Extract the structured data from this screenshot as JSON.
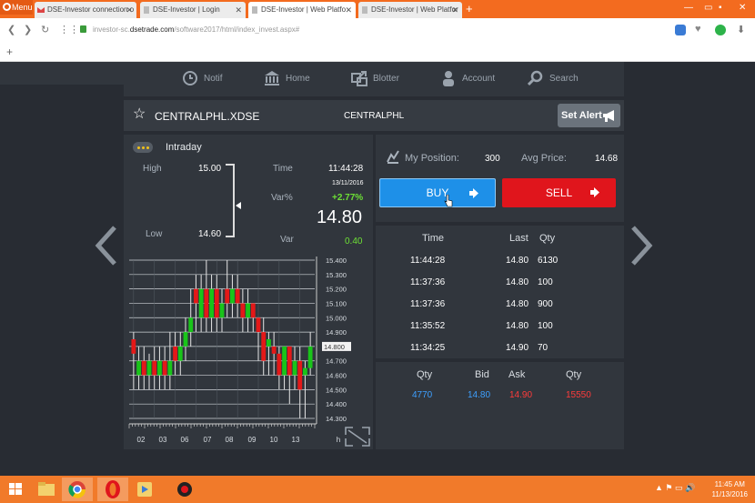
{
  "browser": {
    "menu_label": "Menu",
    "tabs": [
      {
        "title": "DSE-Investor connection o"
      },
      {
        "title": "DSE-Investor | Login"
      },
      {
        "title": "DSE-Investor | Web Platfo"
      },
      {
        "title": "DSE-Investor | Web Platfor"
      }
    ],
    "url_prefix": "investor-sc.",
    "url_domain": "dsetrade.com",
    "url_path": "/software2017/html/index_invest.aspx#"
  },
  "nav": {
    "items": [
      {
        "label": "Notif",
        "icon": "clock-icon"
      },
      {
        "label": "Home",
        "icon": "bank-icon"
      },
      {
        "label": "Blotter",
        "icon": "blotter-icon"
      },
      {
        "label": "Account",
        "icon": "user-icon"
      },
      {
        "label": "Search",
        "icon": "search-icon"
      }
    ]
  },
  "instrument": {
    "symbol": "CENTRALPHL.XDSE",
    "short": "CENTRALPHL",
    "alert_label": "Set Alert"
  },
  "intraday": {
    "title": "Intraday",
    "high_label": "High",
    "high": "15.00",
    "low_label": "Low",
    "low": "14.60",
    "time_label": "Time",
    "time": "11:44:28",
    "date": "13/11/2016",
    "varpct_label": "Var%",
    "varpct": "+2.77%",
    "price": "14.80",
    "var_label": "Var",
    "var": "0.40"
  },
  "position": {
    "label": "My Position:",
    "qty": "300",
    "avg_label": "Avg Price:",
    "avg": "14.68",
    "buy_label": "BUY",
    "sell_label": "SELL"
  },
  "trades": {
    "headers": {
      "time": "Time",
      "last": "Last",
      "qty": "Qty"
    },
    "rows": [
      {
        "time": "11:44:28",
        "last": "14.80",
        "qty": "6130"
      },
      {
        "time": "11:37:36",
        "last": "14.80",
        "qty": "100"
      },
      {
        "time": "11:37:36",
        "last": "14.80",
        "qty": "900"
      },
      {
        "time": "11:35:52",
        "last": "14.80",
        "qty": "100"
      },
      {
        "time": "11:34:25",
        "last": "14.90",
        "qty": "70"
      }
    ]
  },
  "book": {
    "headers": {
      "bid_qty": "Qty",
      "bid": "Bid",
      "ask": "Ask",
      "ask_qty": "Qty"
    },
    "bid_qty": "4770",
    "bid": "14.80",
    "ask": "14.90",
    "ask_qty": "15550"
  },
  "chart_data": {
    "type": "candlestick",
    "y_ticks": [
      "15.400",
      "15.300",
      "15.200",
      "15.100",
      "15.000",
      "14.900",
      "14.800",
      "14.700",
      "14.600",
      "14.500",
      "14.400",
      "14.300"
    ],
    "ylim": [
      14.3,
      15.4
    ],
    "x_ticks": [
      "02",
      "03",
      "06",
      "07",
      "08",
      "09",
      "10",
      "13",
      "h"
    ],
    "current_price_label": "14.800",
    "candles": [
      {
        "o": 14.75,
        "c": 14.85,
        "h": 14.9,
        "l": 14.5,
        "dir": "down"
      },
      {
        "o": 14.6,
        "c": 14.7,
        "h": 14.8,
        "l": 14.5,
        "dir": "up"
      },
      {
        "o": 14.7,
        "c": 14.6,
        "h": 14.8,
        "l": 14.5,
        "dir": "down"
      },
      {
        "o": 14.6,
        "c": 14.7,
        "h": 14.75,
        "l": 14.5,
        "dir": "up"
      },
      {
        "o": 14.7,
        "c": 14.6,
        "h": 14.8,
        "l": 14.5,
        "dir": "down"
      },
      {
        "o": 14.6,
        "c": 14.7,
        "h": 14.8,
        "l": 14.5,
        "dir": "up"
      },
      {
        "o": 14.7,
        "c": 14.6,
        "h": 14.8,
        "l": 14.5,
        "dir": "down"
      },
      {
        "o": 14.6,
        "c": 14.7,
        "h": 14.9,
        "l": 14.5,
        "dir": "up"
      },
      {
        "o": 14.8,
        "c": 14.7,
        "h": 14.9,
        "l": 14.6,
        "dir": "down"
      },
      {
        "o": 14.7,
        "c": 14.8,
        "h": 14.9,
        "l": 14.6,
        "dir": "up"
      },
      {
        "o": 14.8,
        "c": 14.9,
        "h": 15.0,
        "l": 14.7,
        "dir": "up"
      },
      {
        "o": 14.9,
        "c": 15.0,
        "h": 15.2,
        "l": 14.8,
        "dir": "up"
      },
      {
        "o": 15.2,
        "c": 15.1,
        "h": 15.3,
        "l": 14.9,
        "dir": "down"
      },
      {
        "o": 15.0,
        "c": 15.2,
        "h": 15.3,
        "l": 14.9,
        "dir": "up"
      },
      {
        "o": 15.2,
        "c": 15.0,
        "h": 15.4,
        "l": 14.9,
        "dir": "down"
      },
      {
        "o": 15.0,
        "c": 15.2,
        "h": 15.3,
        "l": 14.9,
        "dir": "up"
      },
      {
        "o": 15.2,
        "c": 15.0,
        "h": 15.3,
        "l": 14.9,
        "dir": "down"
      },
      {
        "o": 15.0,
        "c": 15.1,
        "h": 15.2,
        "l": 14.9,
        "dir": "up"
      },
      {
        "o": 15.2,
        "c": 15.1,
        "h": 15.4,
        "l": 15.0,
        "dir": "down"
      },
      {
        "o": 15.1,
        "c": 15.2,
        "h": 15.3,
        "l": 15.0,
        "dir": "up"
      },
      {
        "o": 15.2,
        "c": 15.1,
        "h": 15.3,
        "l": 15.0,
        "dir": "down"
      },
      {
        "o": 15.1,
        "c": 15.0,
        "h": 15.2,
        "l": 14.9,
        "dir": "down"
      },
      {
        "o": 15.0,
        "c": 15.1,
        "h": 15.2,
        "l": 14.9,
        "dir": "up"
      },
      {
        "o": 15.1,
        "c": 15.0,
        "h": 15.1,
        "l": 14.9,
        "dir": "down"
      },
      {
        "o": 15.0,
        "c": 14.9,
        "h": 15.0,
        "l": 14.7,
        "dir": "down"
      },
      {
        "o": 14.9,
        "c": 14.7,
        "h": 15.0,
        "l": 14.6,
        "dir": "down"
      },
      {
        "o": 14.8,
        "c": 14.85,
        "h": 14.9,
        "l": 14.6,
        "dir": "up"
      },
      {
        "o": 14.8,
        "c": 14.75,
        "h": 14.9,
        "l": 14.6,
        "dir": "down"
      },
      {
        "o": 14.75,
        "c": 14.6,
        "h": 14.8,
        "l": 14.5,
        "dir": "down"
      },
      {
        "o": 14.6,
        "c": 14.8,
        "h": 14.8,
        "l": 14.5,
        "dir": "up"
      },
      {
        "o": 14.8,
        "c": 14.6,
        "h": 14.8,
        "l": 14.4,
        "dir": "down"
      },
      {
        "o": 14.6,
        "c": 14.7,
        "h": 14.8,
        "l": 14.5,
        "dir": "up"
      },
      {
        "o": 14.7,
        "c": 14.5,
        "h": 14.8,
        "l": 14.3,
        "dir": "down"
      },
      {
        "o": 14.6,
        "c": 14.65,
        "h": 14.7,
        "l": 14.3,
        "dir": "up"
      },
      {
        "o": 14.65,
        "c": 14.8,
        "h": 14.9,
        "l": 14.6,
        "dir": "up"
      }
    ]
  },
  "taskbar": {
    "time": "11:45 AM",
    "date": "11/13/2016"
  },
  "colors": {
    "up": "#19c419",
    "down": "#e41818",
    "buy": "#1e90e8",
    "sell": "#e0151c",
    "positive": "#6de035",
    "bid": "#3ea0ff",
    "ask": "#ff3b3b"
  }
}
